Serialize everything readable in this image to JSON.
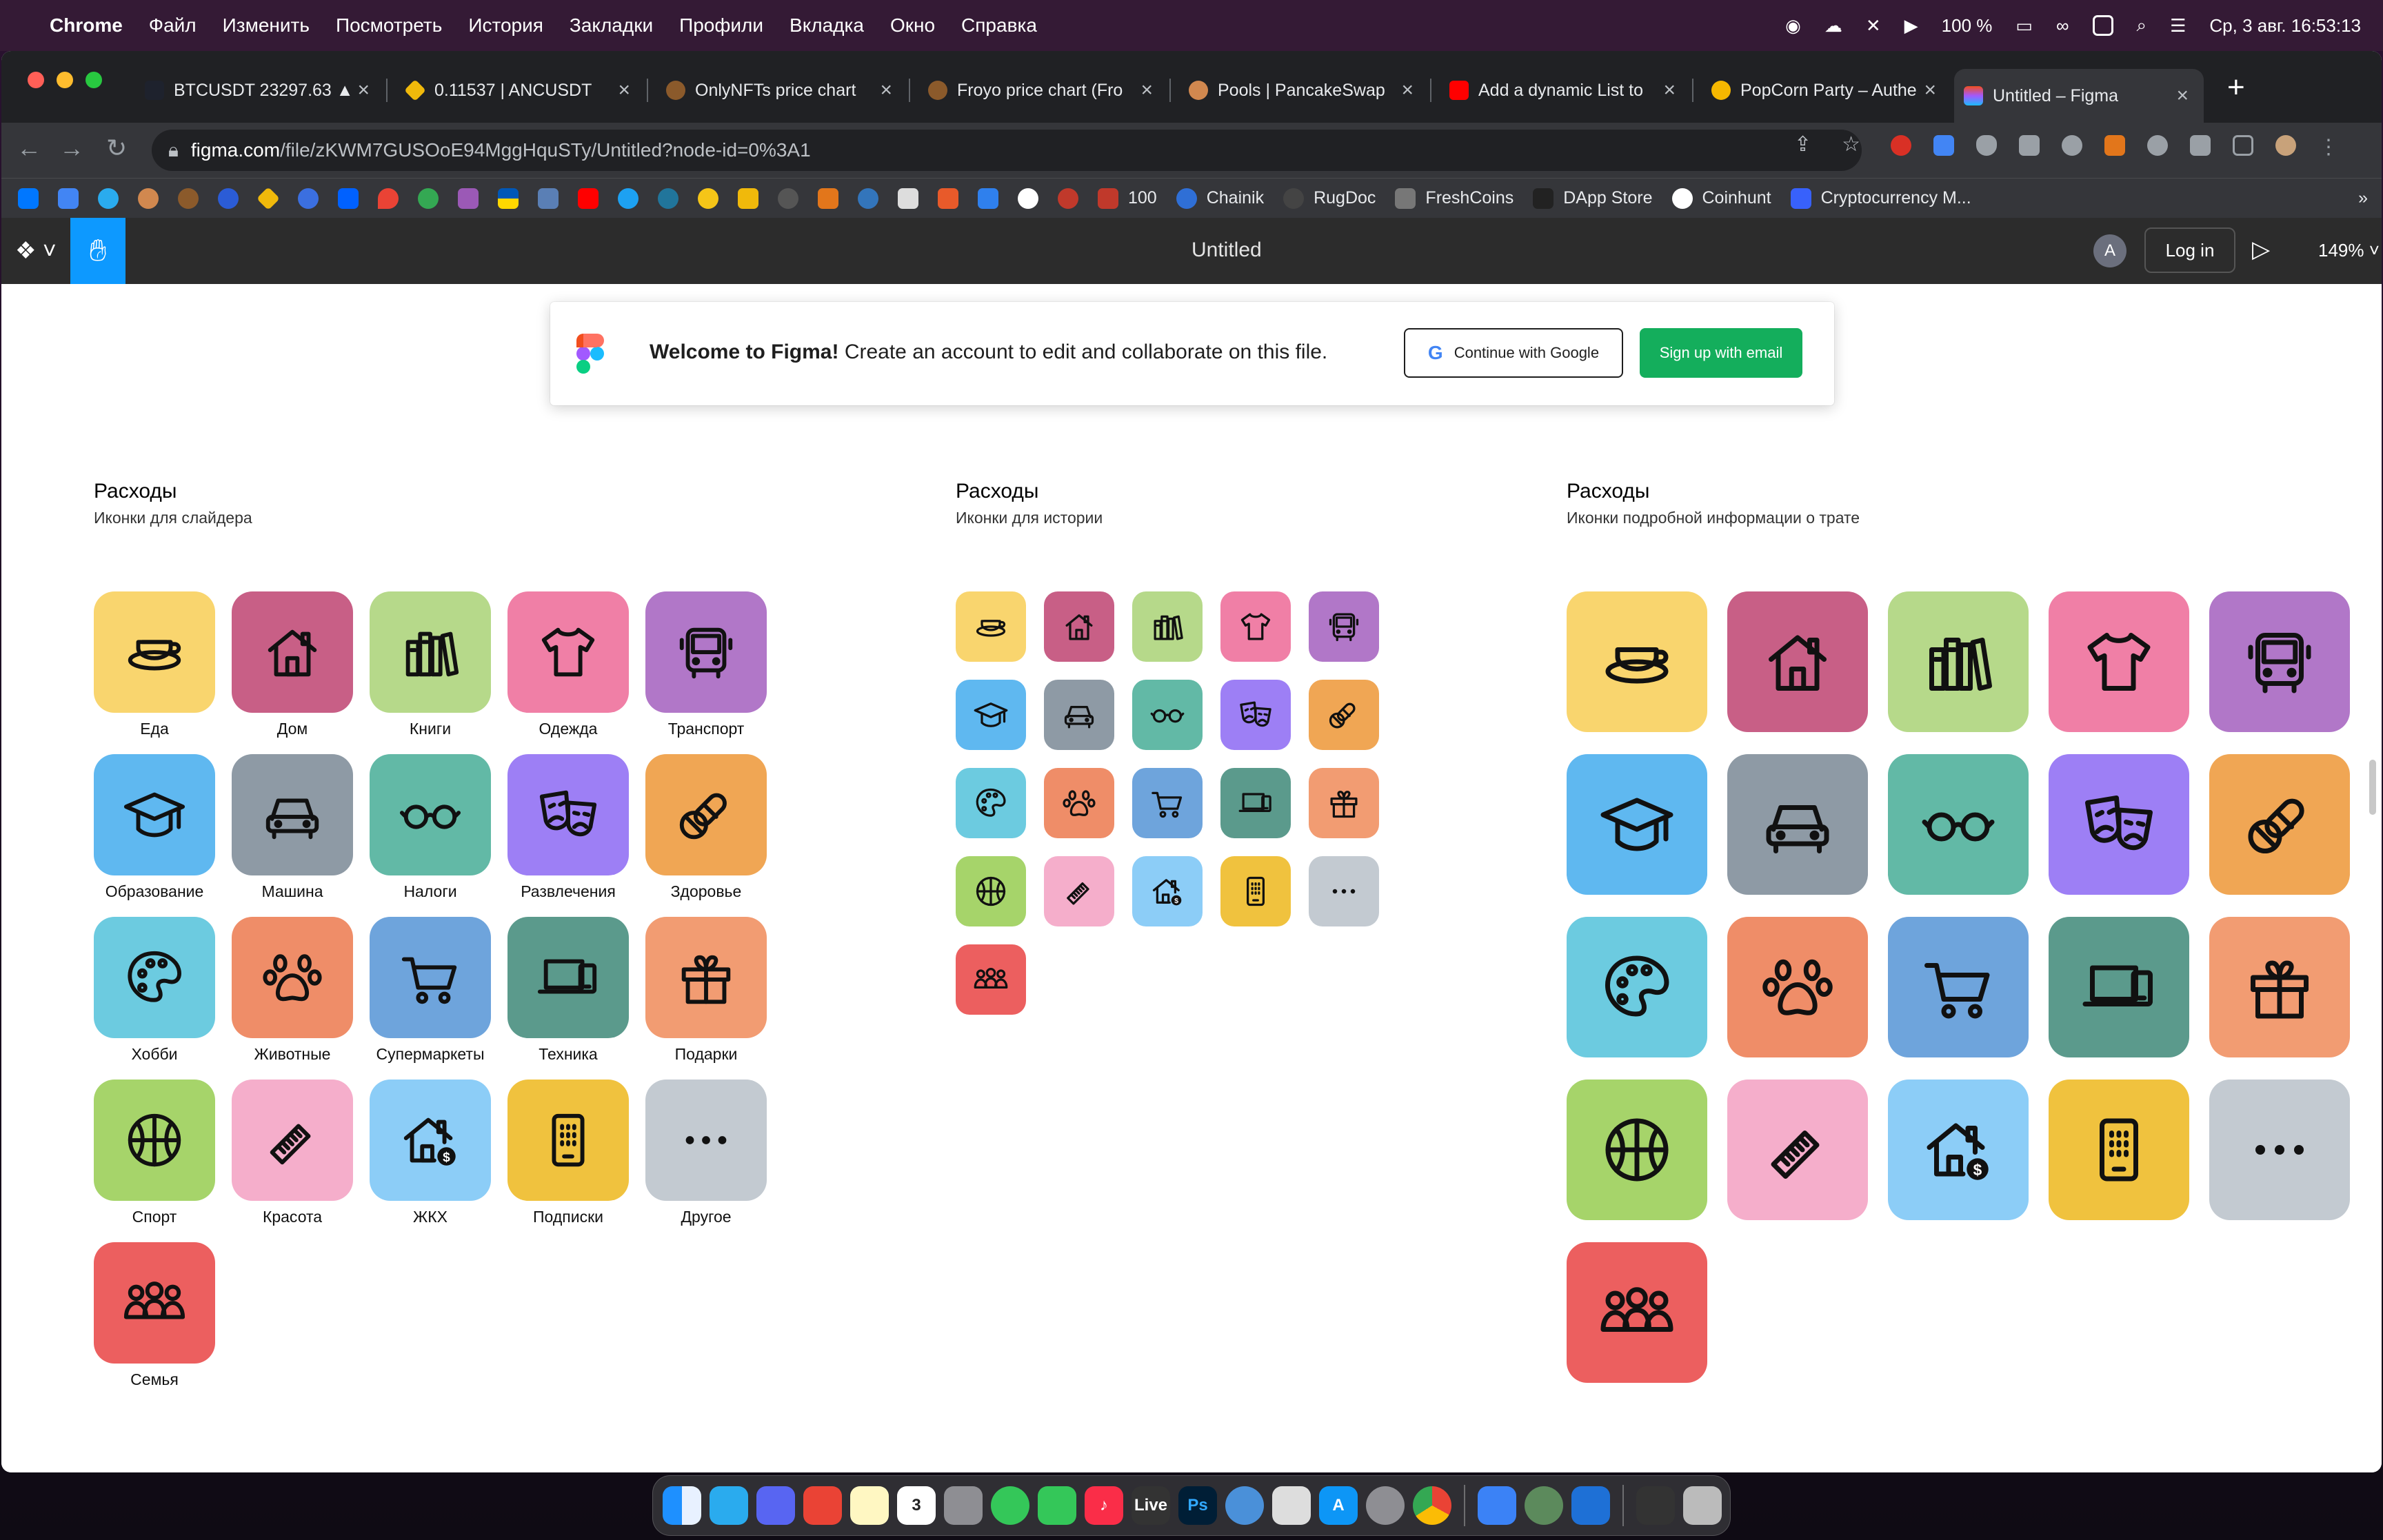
{
  "menubar": {
    "app": "Chrome",
    "items": [
      "Файл",
      "Изменить",
      "Посмотреть",
      "История",
      "Закладки",
      "Профили",
      "Вкладка",
      "Окно",
      "Справка"
    ],
    "battery": "100 %",
    "datetime": "Ср, 3 авг.  16:53:13"
  },
  "tabs": [
    {
      "title": "BTCUSDT 23297.63 ▲",
      "color": "#1e222d"
    },
    {
      "title": "0.11537 | ANCUSDT",
      "color": "#f0b90b"
    },
    {
      "title": "OnlyNFTs price chart",
      "color": "#8b5a2b"
    },
    {
      "title": "Froyo price chart (Fro",
      "color": "#8b5a2b"
    },
    {
      "title": "Pools | PancakeSwap",
      "color": "#d1884f"
    },
    {
      "title": "Add a dynamic List to",
      "color": "#ff0000"
    },
    {
      "title": "PopCorn Party – Authe",
      "color": "#f5b700"
    },
    {
      "title": "Untitled – Figma",
      "color": "#a259ff"
    }
  ],
  "address": {
    "host": "figma.com",
    "path": "/file/zKWM7GUSOoE94MggHquSTy/Untitled?node-id=0%3A1"
  },
  "bookmarks": [
    {
      "label": "100",
      "color": "#c0392b"
    },
    {
      "label": "Chainik",
      "color": "#2f6fd6"
    },
    {
      "label": "RugDoc",
      "color": "#444"
    },
    {
      "label": "FreshCoins",
      "color": "#777"
    },
    {
      "label": "DApp Store",
      "color": "#222"
    },
    {
      "label": "Coinhunt",
      "color": "#fff"
    },
    {
      "label": "Cryptocurrency M...",
      "color": "#3861fb"
    }
  ],
  "figma": {
    "title": "Untitled",
    "avatar": "A",
    "login": "Log in",
    "zoom": "149%"
  },
  "banner": {
    "bold": "Welcome to Figma!",
    "text": " Create an account to edit and collaborate on this file.",
    "google": "Continue with Google",
    "google_g": "G",
    "email": "Sign up with email"
  },
  "sections": [
    {
      "title": "Расходы",
      "subtitle": "Иконки для слайдера"
    },
    {
      "title": "Расходы",
      "subtitle": "Иконки для истории"
    },
    {
      "title": "Расходы",
      "subtitle": "Иконки подробной информации о трате"
    }
  ],
  "categories": [
    {
      "label": "Еда",
      "color": "#f9d56e",
      "icon": "cup-icon"
    },
    {
      "label": "Дом",
      "color": "#c85f86",
      "icon": "house-icon"
    },
    {
      "label": "Книги",
      "color": "#b6d98a",
      "icon": "books-icon"
    },
    {
      "label": "Одежда",
      "color": "#f07fa6",
      "icon": "tshirt-icon"
    },
    {
      "label": "Транспорт",
      "color": "#b177c8",
      "icon": "bus-icon"
    },
    {
      "label": "Образование",
      "color": "#5fb8f0",
      "icon": "graduation-cap-icon"
    },
    {
      "label": "Машина",
      "color": "#8e9aa5",
      "icon": "car-icon"
    },
    {
      "label": "Налоги",
      "color": "#62b9a6",
      "icon": "glasses-icon"
    },
    {
      "label": "Развлечения",
      "color": "#9d7ff5",
      "icon": "theater-masks-icon"
    },
    {
      "label": "Здоровье",
      "color": "#f0a654",
      "icon": "pills-icon"
    },
    {
      "label": "Хобби",
      "color": "#6ccbe0",
      "icon": "palette-icon"
    },
    {
      "label": "Животные",
      "color": "#ef8d68",
      "icon": "paw-icon"
    },
    {
      "label": "Супермаркеты",
      "color": "#6ea4dc",
      "icon": "cart-icon"
    },
    {
      "label": "Техника",
      "color": "#5b9a8c",
      "icon": "devices-icon"
    },
    {
      "label": "Подарки",
      "color": "#f29c72",
      "icon": "gift-icon"
    },
    {
      "label": "Спорт",
      "color": "#a6d46a",
      "icon": "basketball-icon"
    },
    {
      "label": "Красота",
      "color": "#f5aecb",
      "icon": "comb-icon"
    },
    {
      "label": "ЖКХ",
      "color": "#8ccdf7",
      "icon": "house-bill-icon"
    },
    {
      "label": "Подписки",
      "color": "#f0c23e",
      "icon": "phone-icon"
    },
    {
      "label": "Другое",
      "color": "#c3cad1",
      "icon": "more-icon"
    },
    {
      "label": "Семья",
      "color": "#ec5f5f",
      "icon": "family-icon"
    }
  ]
}
